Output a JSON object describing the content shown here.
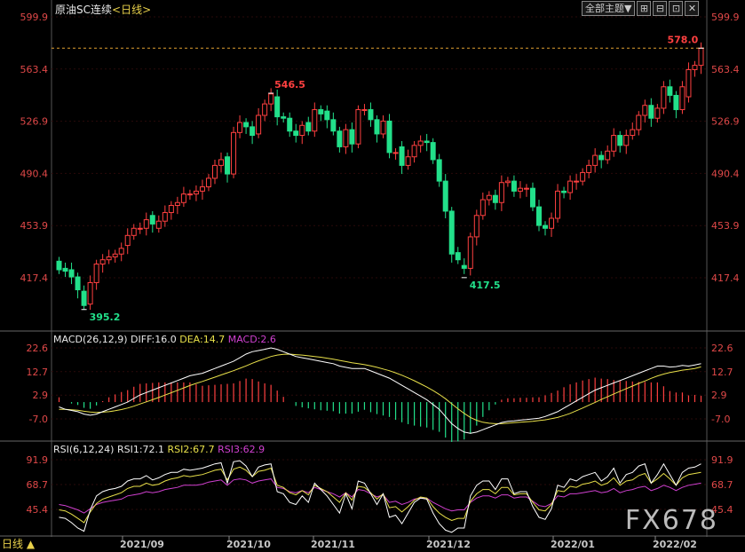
{
  "header": {
    "title": "原油SC连续",
    "period_open": "<",
    "period": "日线",
    "period_close": ">"
  },
  "toolbar": {
    "main_menu": "全部主题▼",
    "icons": [
      "grid-icon",
      "zoom-out-icon",
      "zoom-in-icon",
      "close-icon"
    ],
    "glyphs": [
      "⊞",
      "⊟",
      "⊡",
      "✕"
    ]
  },
  "watermark": "FX678",
  "bottom_label": "日线 ▲",
  "colors": {
    "up": "#ff4040",
    "down": "#22e08a",
    "diff": "#ffffff",
    "dea": "#e8e04a",
    "macd": "#d040d0",
    "rsi1": "#ffffff",
    "rsi2": "#e8e04a",
    "rsi3": "#d040d0",
    "axis": "#e04848",
    "date": "#c8c8c8"
  },
  "macd_panel": {
    "label": "MACD(26,12,9)",
    "diff": "DIFF:16.0",
    "dea": "DEA:14.7",
    "macd": "MACD:2.6"
  },
  "rsi_panel": {
    "label": "RSI(6,12,24)",
    "rsi1": "RSI1:72.1",
    "rsi2": "RSI2:67.7",
    "rsi3": "RSI3:62.9"
  },
  "chart_data": [
    {
      "type": "candlestick",
      "title": "原油SC连续 日线",
      "y_ticks": [
        "599.9",
        "563.4",
        "526.9",
        "490.4",
        "453.9",
        "417.4"
      ],
      "ylim": [
        395.2,
        599.9
      ],
      "x_ticks": [
        "2021/09",
        "2021/10",
        "2021/11",
        "2021/12",
        "2022/01",
        "2022/02"
      ],
      "annotations": [
        {
          "text": "546.5",
          "value": 546.5,
          "kind": "high",
          "index": 34
        },
        {
          "text": "395.2",
          "value": 395.2,
          "kind": "low",
          "index": 4
        },
        {
          "text": "417.5",
          "value": 417.5,
          "kind": "low",
          "index": 65
        },
        {
          "text": "578.0",
          "value": 578.0,
          "kind": "high",
          "index": 103
        }
      ],
      "reference_line": 578.0,
      "closes": [
        423,
        422,
        418,
        409,
        398,
        414,
        427,
        430,
        432,
        434,
        438,
        447,
        452,
        452,
        458,
        455,
        457,
        463,
        468,
        470,
        476,
        476,
        478,
        481,
        487,
        496,
        500,
        490,
        519,
        526,
        523,
        517,
        531,
        539,
        546,
        530,
        529,
        520,
        517,
        524,
        520,
        535,
        532,
        528,
        520,
        509,
        521,
        511,
        535,
        535,
        528,
        518,
        527,
        505,
        505,
        496,
        502,
        510,
        513,
        512,
        500,
        485,
        464,
        434,
        430,
        424,
        446,
        461,
        472,
        475,
        470,
        484,
        485,
        478,
        480,
        480,
        467,
        454,
        452,
        459,
        478,
        477,
        485,
        485,
        491,
        496,
        503,
        500,
        506,
        517,
        510,
        517,
        521,
        531,
        538,
        529,
        536,
        551,
        545,
        535,
        551,
        563,
        566,
        578
      ],
      "opens": [
        429,
        424,
        423,
        418,
        408,
        399,
        414,
        427,
        430,
        432,
        434,
        440,
        447,
        452,
        452,
        461,
        452,
        457,
        463,
        468,
        470,
        476,
        476,
        478,
        481,
        487,
        496,
        502,
        490,
        519,
        526,
        523,
        518,
        531,
        539,
        544,
        530,
        529,
        520,
        517,
        526,
        520,
        535,
        534,
        528,
        520,
        509,
        521,
        511,
        535,
        535,
        528,
        518,
        527,
        505,
        509,
        496,
        502,
        510,
        513,
        512,
        500,
        485,
        464,
        435,
        426,
        424,
        446,
        461,
        472,
        475,
        470,
        484,
        485,
        478,
        480,
        480,
        467,
        454,
        452,
        459,
        478,
        477,
        485,
        485,
        491,
        496,
        503,
        500,
        506,
        517,
        510,
        517,
        521,
        531,
        538,
        529,
        536,
        551,
        545,
        535,
        544,
        563,
        566
      ]
    },
    {
      "type": "bar+line",
      "title": "MACD(26,12,9)",
      "y_ticks": [
        "22.6",
        "12.7",
        "2.9",
        "-7.0"
      ],
      "ylim": [
        -13.0,
        25.0
      ],
      "series": [
        {
          "name": "DIFF",
          "values": [
            -2,
            -3,
            -3.5,
            -4,
            -5,
            -5.5,
            -5,
            -4,
            -3,
            -2,
            -1,
            0,
            1.5,
            3,
            4,
            5,
            6,
            7,
            8,
            9,
            10,
            11,
            11.5,
            12,
            13,
            14,
            15,
            16,
            17,
            18.5,
            20,
            21,
            21.5,
            22,
            22.6,
            22,
            21,
            20,
            19,
            18.5,
            18,
            17.5,
            17,
            16.5,
            16,
            15,
            14.5,
            14,
            14,
            14,
            13,
            12,
            11,
            10,
            8.5,
            7,
            5.5,
            4,
            2.5,
            1,
            -1,
            -3,
            -6,
            -9,
            -11,
            -12.5,
            -13,
            -12.5,
            -11.5,
            -10.5,
            -9.5,
            -8.5,
            -8,
            -7.8,
            -7.5,
            -7.3,
            -7,
            -6.7,
            -6,
            -5,
            -4,
            -2.5,
            -1,
            0.5,
            2,
            3.5,
            5,
            6,
            7,
            8,
            9,
            10,
            11,
            12,
            13,
            14,
            15,
            15,
            14.6,
            14.8,
            15.3,
            15,
            15.5,
            16
          ]
        },
        {
          "name": "DEA",
          "values": [
            -3,
            -3,
            -3.2,
            -3.4,
            -3.8,
            -4.1,
            -4.3,
            -4.2,
            -4,
            -3.6,
            -3.1,
            -2.5,
            -1.7,
            -0.8,
            0.1,
            1,
            1.9,
            2.9,
            3.9,
            4.9,
            5.9,
            6.9,
            7.8,
            8.6,
            9.5,
            10.4,
            11.3,
            12.2,
            13.1,
            14.1,
            15.1,
            16.2,
            17.2,
            18.1,
            19,
            19.6,
            19.9,
            20,
            19.8,
            19.6,
            19.3,
            19,
            18.7,
            18.3,
            17.9,
            17.4,
            16.9,
            16.4,
            16,
            15.6,
            15.1,
            14.5,
            13.8,
            13.1,
            12.2,
            11.2,
            10.1,
            8.9,
            7.6,
            6.3,
            4.8,
            3.2,
            1.4,
            -0.7,
            -2.8,
            -4.7,
            -6.4,
            -7.6,
            -8.4,
            -8.8,
            -9,
            -9,
            -8.8,
            -8.6,
            -8.4,
            -8.2,
            -8,
            -7.7,
            -7.4,
            -6.9,
            -6.4,
            -5.6,
            -4.7,
            -3.6,
            -2.5,
            -1.3,
            -0.1,
            1.1,
            2.2,
            3.4,
            4.5,
            5.6,
            6.7,
            7.8,
            8.8,
            9.9,
            10.9,
            11.7,
            12.3,
            12.8,
            13.3,
            13.6,
            14,
            14.7
          ]
        }
      ]
    },
    {
      "type": "line",
      "title": "RSI(6,12,24)",
      "y_ticks": [
        "91.9",
        "68.7",
        "45.4"
      ],
      "ylim": [
        23,
        100
      ],
      "series": [
        {
          "name": "RSI1",
          "values": [
            38,
            37,
            33,
            28,
            25,
            45,
            58,
            62,
            64,
            65,
            67,
            72,
            74,
            74,
            77,
            73,
            75,
            78,
            80,
            80,
            83,
            82,
            83,
            84,
            86,
            88,
            89,
            70,
            90,
            91,
            86,
            76,
            85,
            87,
            88,
            62,
            60,
            52,
            50,
            58,
            52,
            70,
            64,
            58,
            50,
            42,
            60,
            46,
            72,
            70,
            60,
            50,
            60,
            38,
            40,
            32,
            42,
            52,
            56,
            55,
            42,
            32,
            26,
            24,
            28,
            28,
            58,
            68,
            72,
            72,
            64,
            74,
            74,
            60,
            62,
            62,
            48,
            38,
            36,
            46,
            68,
            66,
            74,
            72,
            76,
            78,
            80,
            72,
            76,
            84,
            70,
            78,
            80,
            86,
            88,
            70,
            78,
            88,
            78,
            68,
            80,
            84,
            85,
            88
          ]
        },
        {
          "name": "RSI2",
          "values": [
            45,
            44,
            41,
            37,
            33,
            43,
            51,
            55,
            57,
            59,
            61,
            65,
            67,
            67,
            70,
            68,
            69,
            72,
            74,
            75,
            77,
            76,
            77,
            78,
            80,
            82,
            83,
            73,
            83,
            85,
            82,
            76,
            81,
            82,
            84,
            68,
            66,
            61,
            59,
            63,
            59,
            68,
            65,
            62,
            57,
            52,
            61,
            54,
            67,
            66,
            61,
            55,
            60,
            47,
            48,
            43,
            48,
            54,
            57,
            56,
            48,
            42,
            38,
            35,
            37,
            37,
            53,
            60,
            64,
            64,
            60,
            66,
            66,
            59,
            60,
            60,
            52,
            45,
            44,
            50,
            63,
            62,
            67,
            66,
            69,
            70,
            72,
            68,
            70,
            75,
            68,
            72,
            73,
            77,
            79,
            70,
            74,
            79,
            74,
            68,
            75,
            78,
            79,
            80
          ]
        },
        {
          "name": "RSI3",
          "values": [
            50,
            49,
            47,
            45,
            42,
            46,
            50,
            52,
            53,
            54,
            55,
            58,
            59,
            60,
            62,
            61,
            62,
            64,
            65,
            66,
            68,
            68,
            68,
            69,
            71,
            72,
            73,
            68,
            73,
            74,
            73,
            70,
            72,
            73,
            74,
            66,
            65,
            62,
            61,
            63,
            61,
            66,
            64,
            62,
            60,
            57,
            61,
            57,
            64,
            63,
            60,
            57,
            59,
            52,
            53,
            50,
            52,
            55,
            56,
            56,
            52,
            49,
            46,
            44,
            45,
            45,
            52,
            56,
            58,
            58,
            56,
            59,
            59,
            56,
            57,
            57,
            53,
            49,
            48,
            51,
            58,
            57,
            60,
            60,
            61,
            62,
            63,
            61,
            62,
            65,
            61,
            63,
            64,
            66,
            67,
            63,
            65,
            68,
            66,
            63,
            66,
            68,
            69,
            70
          ]
        }
      ]
    }
  ]
}
